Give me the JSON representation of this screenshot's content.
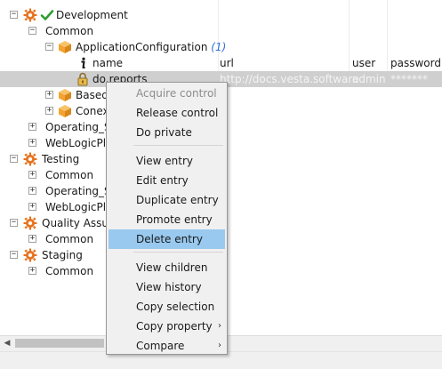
{
  "columns": {
    "name": "name",
    "url": "url",
    "user": "user",
    "password": "password"
  },
  "tree": {
    "development": "Development",
    "dev_common": "Common",
    "app_config": "ApplicationConfiguration",
    "app_config_count": "(1)",
    "entry_name": "do.reports",
    "entry_url": "http://docs.vesta.software",
    "entry_user": "admin",
    "entry_password": "*******",
    "basedef": "Basede",
    "conex": "Conex",
    "operating_1": "Operating_Sy",
    "weblogic_1": "WebLogicPlu",
    "testing": "Testing",
    "test_common": "Common",
    "operating_2": "Operating_Sy",
    "weblogic_2": "WebLogicPlu",
    "qa": "Quality Assura",
    "qa_common": "Common",
    "staging": "Staging",
    "staging_common": "Common"
  },
  "menu": {
    "acquire": "Acquire control",
    "release": "Release control",
    "private": "Do private",
    "view_entry": "View entry",
    "edit_entry": "Edit entry",
    "duplicate_entry": "Duplicate entry",
    "promote_entry": "Promote entry",
    "delete_entry": "Delete entry",
    "view_children": "View children",
    "view_history": "View history",
    "copy_selection": "Copy selection",
    "copy_property": "Copy property",
    "compare": "Compare"
  },
  "icons": {
    "gear": "gear-icon",
    "check": "check-icon",
    "cube": "cube-icon",
    "info": "info-icon",
    "lock": "lock-icon",
    "submenu": "chevron-right-icon",
    "scroll_left": "arrow-left-icon"
  },
  "colors": {
    "gear_orange": "#e8711c",
    "check_green": "#2e9e32",
    "cube_orange": "#f2a431",
    "count_blue": "#2f6fd6",
    "selection_gray": "#cfcfcf",
    "menu_highlight": "#99c9ef"
  }
}
